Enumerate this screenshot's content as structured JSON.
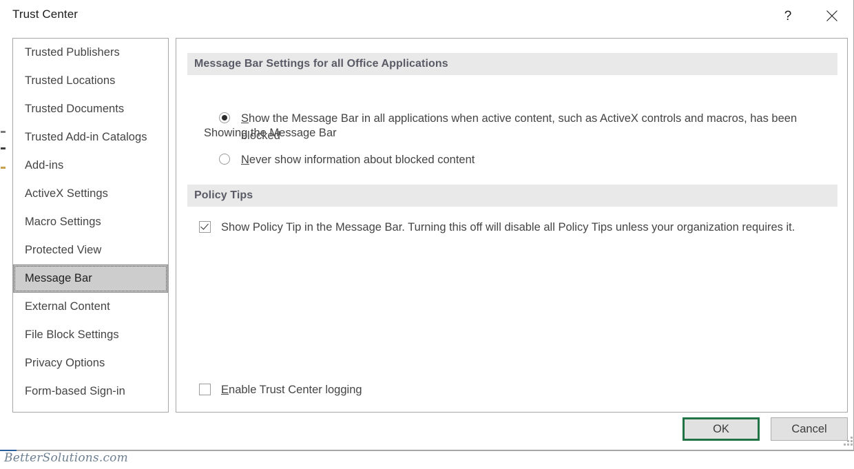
{
  "window": {
    "title": "Trust Center",
    "help_icon": "question-mark-icon",
    "close_icon": "close-x-icon"
  },
  "sidebar": {
    "items": [
      {
        "label": "Trusted Publishers",
        "selected": false
      },
      {
        "label": "Trusted Locations",
        "selected": false
      },
      {
        "label": "Trusted Documents",
        "selected": false
      },
      {
        "label": "Trusted Add-in Catalogs",
        "selected": false
      },
      {
        "label": "Add-ins",
        "selected": false
      },
      {
        "label": "ActiveX Settings",
        "selected": false
      },
      {
        "label": "Macro Settings",
        "selected": false
      },
      {
        "label": "Protected View",
        "selected": false
      },
      {
        "label": "Message Bar",
        "selected": true
      },
      {
        "label": "External Content",
        "selected": false
      },
      {
        "label": "File Block Settings",
        "selected": false
      },
      {
        "label": "Privacy Options",
        "selected": false
      },
      {
        "label": "Form-based Sign-in",
        "selected": false
      }
    ]
  },
  "content": {
    "message_bar_group": {
      "header": "Message Bar Settings for all Office Applications",
      "sub_label": "Showing the Message Bar",
      "radios": [
        {
          "accelerator": "S",
          "label_rest": "how the Message Bar in all applications when active content, such as ActiveX controls and macros, has been blocked",
          "checked": true
        },
        {
          "accelerator": "N",
          "label_rest": "ever show information about blocked content",
          "checked": false
        }
      ]
    },
    "policy_tips_group": {
      "header": "Policy Tips",
      "checkbox": {
        "label": "Show Policy Tip in the Message Bar. Turning this off will disable all Policy Tips unless your organization requires it.",
        "checked": true
      }
    },
    "logging_checkbox": {
      "accelerator": "E",
      "label_rest": "nable Trust Center logging",
      "checked": false
    }
  },
  "footer": {
    "ok_label": "OK",
    "cancel_label": "Cancel",
    "resize_grip_icon": "resize-grip-icon"
  },
  "watermark": {
    "text": "BetterSolutions.com"
  },
  "colors": {
    "accent_green": "#217346",
    "group_header_bg": "#e9e9e9",
    "selected_item_bg": "#cdcdcd",
    "border_gray": "#a6a6a6"
  }
}
